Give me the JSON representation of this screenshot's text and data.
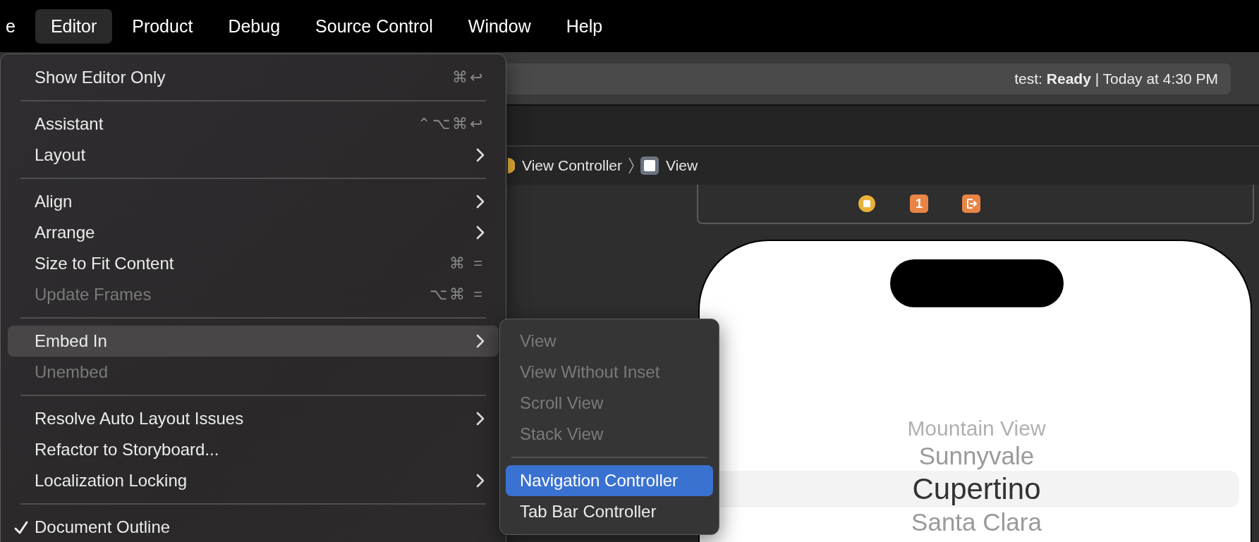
{
  "menu_bar": [
    {
      "label": "e",
      "selected": false
    },
    {
      "label": "Editor",
      "selected": true
    },
    {
      "label": "Product",
      "selected": false
    },
    {
      "label": "Debug",
      "selected": false
    },
    {
      "label": "Source Control",
      "selected": false
    },
    {
      "label": "Window",
      "selected": false
    },
    {
      "label": "Help",
      "selected": false
    }
  ],
  "activity_status": "test: **Ready** | Today at 4:30 PM",
  "breadcrumb": [
    {
      "kind": "controller",
      "label": "View Controller"
    },
    {
      "kind": "view",
      "label": "View"
    }
  ],
  "scene_dock": [
    {
      "kind": "controller"
    },
    {
      "kind": "first-responder",
      "label": "1"
    },
    {
      "kind": "exit"
    }
  ],
  "picker": [
    {
      "label": "Mountain View",
      "selected": false
    },
    {
      "label": "Sunnyvale",
      "selected": false
    },
    {
      "label": "Cupertino",
      "selected": true
    },
    {
      "label": "Santa Clara",
      "selected": false
    }
  ],
  "editor_menu": [
    {
      "kind": "item",
      "label": "Show Editor Only",
      "shortcut": "⌘↩",
      "submenu": false,
      "disabled": false,
      "selected": false,
      "checked": false
    },
    {
      "kind": "separator"
    },
    {
      "kind": "item",
      "label": "Assistant",
      "shortcut": "⌃⌥⌘↩",
      "submenu": false,
      "disabled": false,
      "selected": false,
      "checked": false
    },
    {
      "kind": "item",
      "label": "Layout",
      "submenu": true,
      "disabled": false,
      "selected": false,
      "checked": false
    },
    {
      "kind": "separator"
    },
    {
      "kind": "item",
      "label": "Align",
      "submenu": true,
      "disabled": false,
      "selected": false,
      "checked": false
    },
    {
      "kind": "item",
      "label": "Arrange",
      "submenu": true,
      "disabled": false,
      "selected": false,
      "checked": false
    },
    {
      "kind": "item",
      "label": "Size to Fit Content",
      "shortcut": "⌘ =",
      "submenu": false,
      "disabled": false,
      "selected": false,
      "checked": false
    },
    {
      "kind": "item",
      "label": "Update Frames",
      "shortcut": "⌥⌘ =",
      "submenu": false,
      "disabled": true,
      "selected": false,
      "checked": false
    },
    {
      "kind": "separator"
    },
    {
      "kind": "item",
      "label": "Embed In",
      "submenu": true,
      "disabled": false,
      "selected": true,
      "checked": false
    },
    {
      "kind": "item",
      "label": "Unembed",
      "submenu": false,
      "disabled": true,
      "selected": false,
      "checked": false
    },
    {
      "kind": "separator"
    },
    {
      "kind": "item",
      "label": "Resolve Auto Layout Issues",
      "submenu": true,
      "disabled": false,
      "selected": false,
      "checked": false
    },
    {
      "kind": "item",
      "label": "Refactor to Storyboard...",
      "submenu": false,
      "disabled": false,
      "selected": false,
      "checked": false
    },
    {
      "kind": "item",
      "label": "Localization Locking",
      "submenu": true,
      "disabled": false,
      "selected": false,
      "checked": false
    },
    {
      "kind": "separator"
    },
    {
      "kind": "item",
      "label": "Document Outline",
      "submenu": false,
      "disabled": false,
      "selected": false,
      "checked": true
    }
  ],
  "embed_in_submenu": [
    {
      "kind": "item",
      "label": "View",
      "disabled": true,
      "selected": false
    },
    {
      "kind": "item",
      "label": "View Without Inset",
      "disabled": true,
      "selected": false
    },
    {
      "kind": "item",
      "label": "Scroll View",
      "disabled": true,
      "selected": false
    },
    {
      "kind": "item",
      "label": "Stack View",
      "disabled": true,
      "selected": false
    },
    {
      "kind": "separator"
    },
    {
      "kind": "item",
      "label": "Navigation Controller",
      "disabled": false,
      "selected": true
    },
    {
      "kind": "item",
      "label": "Tab Bar Controller",
      "disabled": false,
      "selected": false
    }
  ]
}
